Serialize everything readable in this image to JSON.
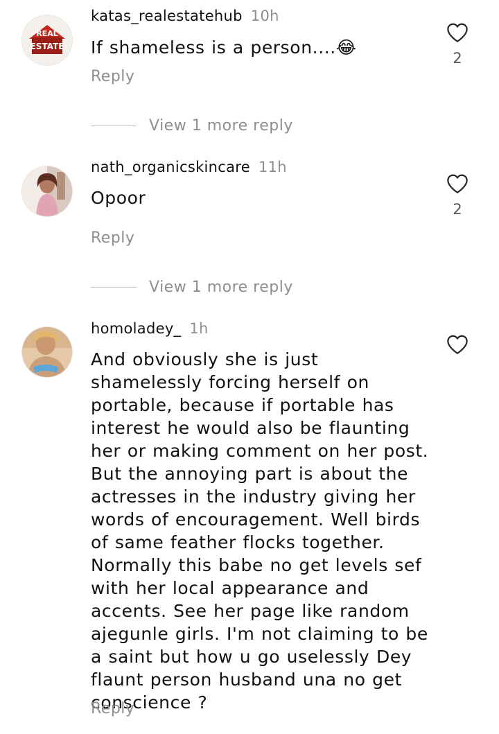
{
  "comments": [
    {
      "username": "katas_realestatehub",
      "time": "10h",
      "text": "If shameless is a person....😂",
      "likes": "2",
      "reply_label": "Reply",
      "avatar_logo_text": "REAL ESTATE",
      "view_more": "View 1 more reply"
    },
    {
      "username": "nath_organicskincare",
      "time": "11h",
      "text": "Opoor",
      "likes": "2",
      "reply_label": "Reply",
      "view_more": "View 1 more reply"
    },
    {
      "username": "homoladey_",
      "time": "1h",
      "text": "And obviously she is just shamelessly forcing herself on portable, because if portable has interest he would also be flaunting her or making comment on her post. But the annoying part is about the actresses in the industry giving her words of encouragement. Well birds of same feather flocks together. Normally this babe no get levels sef with her local appearance and accents. See her page like random ajegunle girls. I'm not claiming to be a saint but how u go uselessly Dey flaunt person husband una no get conscience ?",
      "reply_label": "Reply"
    }
  ],
  "icons": {
    "like": "heart-outline-icon"
  },
  "colors": {
    "muted": "#8e8e8e",
    "text": "#111111"
  }
}
